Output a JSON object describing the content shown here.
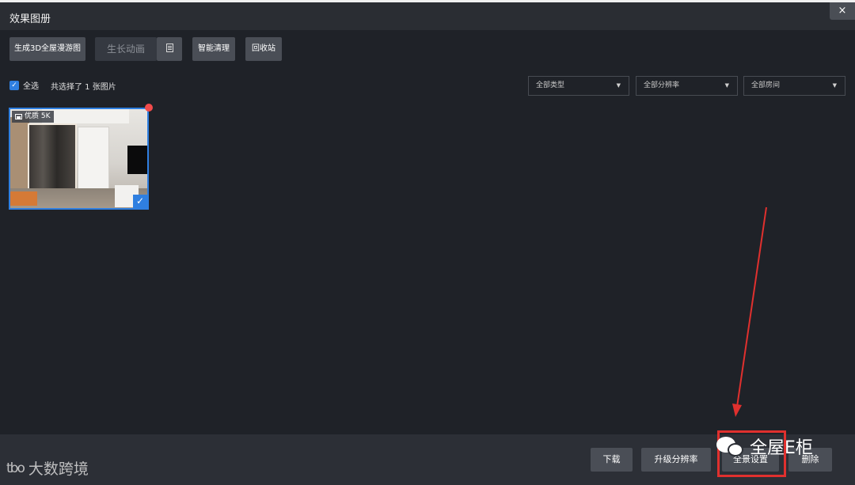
{
  "window": {
    "title": "效果图册",
    "close_label": "×"
  },
  "toolbar": {
    "generate_3d_label": "生成3D全屋漫游图",
    "grow_animation_label": "生长动画",
    "smart_clean_label": "智能清理",
    "recycle_bin_label": "回收站"
  },
  "selection": {
    "select_all_label": "全选",
    "select_all_checked": true,
    "count_text": "共选择了 1 张图片"
  },
  "filters": [
    {
      "label": "全部类型"
    },
    {
      "label": "全部分辨率"
    },
    {
      "label": "全部房间"
    }
  ],
  "gallery": {
    "items": [
      {
        "badge": "优质 5K",
        "selected": true,
        "has_new_dot": true
      }
    ]
  },
  "bottom_actions": {
    "download_label": "下载",
    "upgrade_resolution_label": "升级分辨率",
    "panorama_settings_label": "全景设置",
    "delete_label": "删除"
  },
  "annotations": {
    "highlight_color": "#e0302e",
    "watermark_right": "全屋E柜",
    "watermark_left": "大数跨境",
    "watermark_left_logo": "tbo"
  },
  "colors": {
    "accent": "#2f7fe0",
    "background": "#1f2228",
    "button": "#4a4e56"
  }
}
